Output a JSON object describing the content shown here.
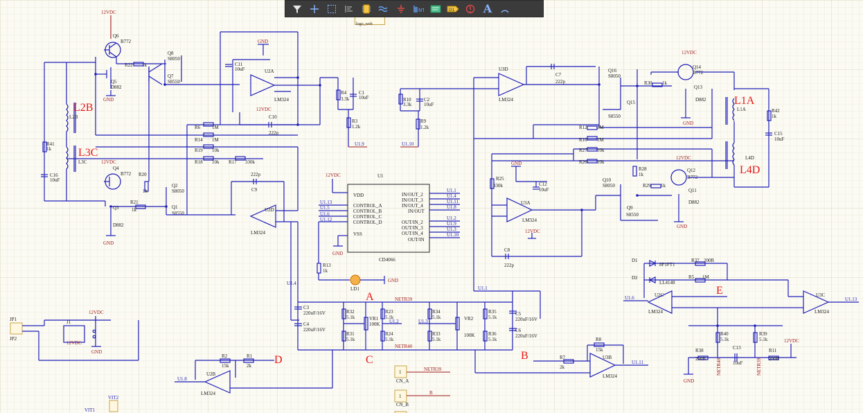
{
  "toolbar": {
    "tools": [
      "filter-icon",
      "crosshair-icon",
      "select-rect-icon",
      "align-icon",
      "component-icon",
      "wire-icon",
      "ground-icon",
      "bus-icon",
      "net-label-icon",
      "part-label-icon",
      "port-icon",
      "text-icon",
      "arc-icon"
    ],
    "text_tool_glyph": "A"
  },
  "logo": {
    "label": "logo_web"
  },
  "labels": {
    "power": "12VDC",
    "gnd": "GND",
    "big": {
      "l2b": "L2B",
      "l3c": "L3C",
      "l1a": "L1A",
      "l4d": "L4D",
      "a": "A",
      "b": "B",
      "c": "C",
      "d": "D",
      "e": "E"
    }
  },
  "components": {
    "q6": "Q6",
    "b772": "B772",
    "q8": "Q8",
    "s8050": "S8050",
    "q5": "Q5",
    "d882": "D882",
    "q7": "Q7",
    "s8550": "S8550",
    "r22": "R22",
    "k1": "1k",
    "c11": "C11",
    "uf10": "10uF",
    "u2a": "U2A",
    "lm324": "LM324",
    "r4": "R4",
    "k33": "3.3k",
    "c1": "C1",
    "r3": "R3",
    "k12": "1.2k",
    "u19": "U1.9",
    "c10": "C10",
    "p222": "222p",
    "r6": "R6",
    "m1": "1M",
    "r14": "R14",
    "r19": "R19",
    "k10": "10k",
    "r18": "R18",
    "r17": "R17",
    "k330": "330k",
    "r41": "R41",
    "c16": "C16",
    "l2b_s": "L2B",
    "l3c_s": "L3C",
    "q4": "Q4",
    "r20": "R20",
    "q2": "Q2",
    "r21": "R21",
    "q3": "Q3",
    "q1": "Q1",
    "c9": "C9",
    "u2d": "U2D",
    "u1": "U1",
    "vdd": "VDD",
    "vss": "VSS",
    "cd4066": "CD4066",
    "ctrl_a": "CONTROL_A",
    "ctrl_b": "CONTROL_B",
    "ctrl_c": "CONTROL_C",
    "ctrl_d": "CONTROL_D",
    "io2": "IN/OUT_2",
    "io3": "IN/OUT_3",
    "io4": "IN/OUT_4",
    "io": "IN/OUT",
    "oi2": "OUT/IN_2",
    "oi3": "OUT/IN_3",
    "oi4": "OUT/IN_4",
    "oi": "OUT/IN",
    "u11": "U1.1",
    "u14": "U1.4",
    "u111": "U1.11",
    "u18": "U1.8",
    "u113": "U1.13",
    "u15": "U1.5",
    "u16": "U1.6",
    "u112": "U1.12",
    "u13": "U1.3",
    "u110": "U1.10",
    "u12": "U1.2",
    "r13": "R13",
    "ld1": "LD1",
    "r10": "R10",
    "c2": "C2",
    "r9": "R9",
    "u3d": "U3D",
    "c7": "C7",
    "q16": "Q16",
    "r30": "R30",
    "q14": "Q14",
    "q13": "Q13",
    "q15": "Q15",
    "r12": "R12",
    "r16": "R16",
    "r27": "R27",
    "r26": "R26",
    "r42": "R42",
    "c15": "C15",
    "l1a_s": "L1A",
    "l4d_s": "L4D",
    "r25": "R25",
    "c12": "C12",
    "u3a": "U3A",
    "c8": "C8",
    "r28": "R28",
    "q12": "Q12",
    "q10": "Q10",
    "r29": "R29",
    "q11": "Q11",
    "q9": "Q9",
    "c3": "C3",
    "c4": "C4",
    "uf220": "220uF/16V",
    "r32": "R32",
    "k51": "5.1k",
    "vr1": "VR1",
    "k100": "100K",
    "r31": "R31",
    "r23": "R23",
    "r24": "R24",
    "r34": "R34",
    "r33": "R33",
    "vr2": "VR2",
    "r35": "R35",
    "r36": "R36",
    "c5": "C5",
    "c6": "C6",
    "netr39": "NETR39",
    "netr40": "NETR40",
    "d1": "D1",
    "d2": "D2",
    "bp": "8P1FT1",
    "ll4148": "LL4148",
    "r37": "R37",
    "r200": "200R",
    "r5": "R5",
    "u2c": "U2C",
    "u3c": "U3C",
    "r40": "R40",
    "c13": "C13",
    "r39": "R39",
    "r38": "R38",
    "r11": "R11",
    "r8": "R8",
    "k15": "15k",
    "r7": "R7",
    "k2": "2k",
    "u3b": "U3B",
    "r2": "R2",
    "r1": "R1",
    "u2b": "U2B",
    "jp1": "JP1",
    "jp2": "JP2",
    "j1": "J1",
    "vit1": "VIT1",
    "vit2": "VIT2",
    "cn_a": "CN_A",
    "cn_b": "CN_B",
    "netr39_a": "NETR39",
    "b_net": "B"
  }
}
